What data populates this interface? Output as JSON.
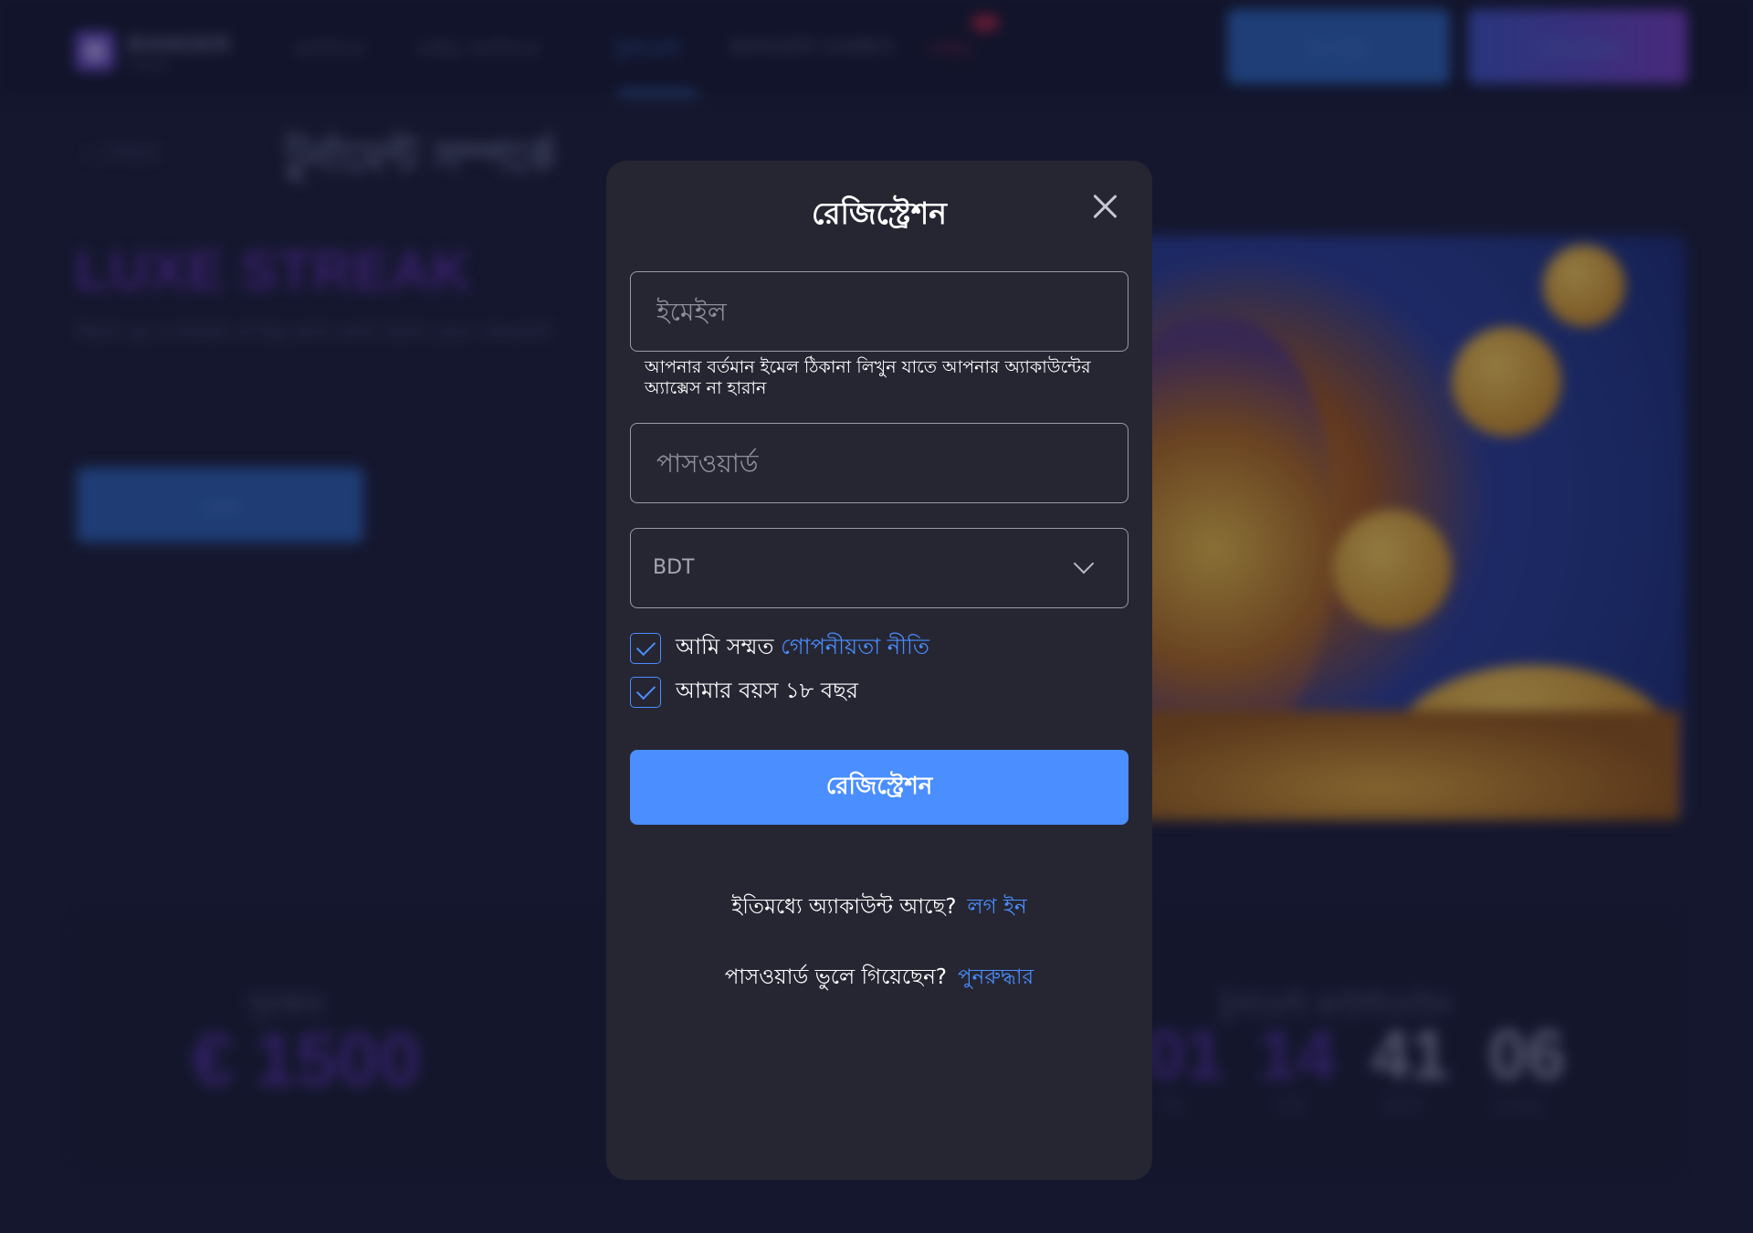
{
  "background": {
    "header": {
      "brand": "BANGER",
      "brand_sub": "CASINO",
      "nav": [
        "ক্যাসিনো",
        "লাইভ ক্যাসিনো",
        "টুর্নামেন্ট",
        "BANGER GAMES",
        "লাইভ"
      ],
      "login_label": "লগ ইন",
      "register_label": "রেজিস্ট্রেশন"
    },
    "back_label": "পেছনে",
    "page_title": "টুর্নামেন্ট সম্পর্কে",
    "promo_name": "LUXE STREAK",
    "promo_description": "Rack up a streak of big wins and claim your reward!",
    "join_label": "যোগ",
    "prize_label": "পুরস্কার",
    "prize_value": "€ 1500",
    "countdown_label": "টুর্নামেন্ট কাউন্টডাউন",
    "countdown": [
      {
        "value": "01",
        "unit": "দিন"
      },
      {
        "value": "14",
        "unit": "ঘণ্টা"
      },
      {
        "value": "41",
        "unit": "মিনিট"
      },
      {
        "value": "06",
        "unit": "সেকেন্ড"
      }
    ]
  },
  "modal": {
    "title": "রেজিস্ট্রেশন",
    "email_placeholder": "ইমেইল",
    "email_value": "",
    "email_hint": "আপনার বর্তমান ইমেল ঠিকানা লিখুন যাতে আপনার অ্যাকাউন্টের অ্যাক্সেস না হারান",
    "password_placeholder": "পাসওয়ার্ড",
    "password_value": "",
    "currency_selected": "BDT",
    "checkbox_privacy_prefix": "আমি সম্মত",
    "checkbox_privacy_link": "গোপনীয়তা নীতি",
    "checkbox_age": "আমার বয়স ১৮ বছর",
    "submit_label": "রেজিস্ট্রেশন",
    "have_account_text": "ইতিমধ্যে অ্যাকাউন্ট আছে?",
    "login_link": "লগ ইন",
    "forgot_text": "পাসওয়ার্ড ভুলে গিয়েছেন?",
    "recover_link": "পুনরুদ্ধার"
  },
  "colors": {
    "accent": "#4a8eff",
    "modal_bg": "#262633",
    "page_bg": "#1c1e3a"
  },
  "icons": {
    "close": "close-icon",
    "dropdown": "chevron-down-icon",
    "checkbox": "check-icon"
  }
}
